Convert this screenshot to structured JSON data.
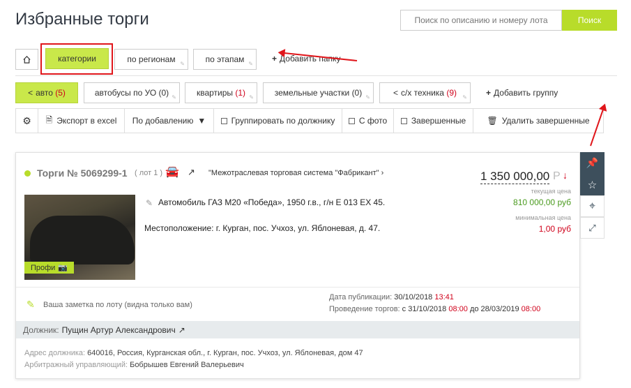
{
  "header": {
    "title": "Избранные торги",
    "search_placeholder": "Поиск по описанию и номеру лота",
    "search_button": "Поиск"
  },
  "folders": {
    "categories": "категории",
    "regions": "по регионам",
    "stages": "по этапам",
    "add_folder": "Добавить папку"
  },
  "groups": [
    {
      "label": "авто",
      "count": "(5)"
    },
    {
      "label": "автобусы по УО",
      "count": "(0)"
    },
    {
      "label": "квартиры",
      "count": "(1)"
    },
    {
      "label": "земельные участки",
      "count": "(0)"
    },
    {
      "label": "с/х техника",
      "count": "(9)"
    }
  ],
  "add_group": "Добавить группу",
  "toolbar": {
    "export": "Экспорт в excel",
    "sort": "По добавлению",
    "group_by_debtor": "Группировать по должнику",
    "with_photo": "С фото",
    "finished": "Завершенные",
    "delete_finished": "Удалить завершенные"
  },
  "lot": {
    "title": "Торги № 5069299-1",
    "lot_no": "( лот 1 )",
    "platform": "\"Межотраслевая торговая система \"Фабрикант\"",
    "price": "1 350 000,00",
    "currency": "Р",
    "current_price_label": "текущая цена",
    "current_price": "810 000,00 руб",
    "min_price_label": "минимальная цена",
    "min_price": "1,00 руб",
    "description": "Автомобиль ГАЗ М20 «Победа», 1950 г.в., г/н Е 013 ЕХ 45.",
    "location": "Местоположение: г. Курган, пос. Учхоз, ул. Яблоневая, д. 47.",
    "photo_badge": "Профи",
    "note": "Ваша заметка по лоту (видна только вам)",
    "pub_date_label": "Дата публикации:",
    "pub_date": "30/10/2018",
    "pub_time": "13:41",
    "trade_label": "Проведение торгов:",
    "trade_from": "с 31/10/2018",
    "trade_from_time": "08:00",
    "trade_to": "до 28/03/2019",
    "trade_to_time": "08:00",
    "debtor_label": "Должник:",
    "debtor": "Пущин Артур Александрович",
    "address_label": "Адрес должника:",
    "address": "640016, Россия, Курганская обл., г. Курган, пос. Учхоз, ул. Яблоневая, дом 47",
    "manager_label": "Арбитражный управляющий:",
    "manager": "Бобрышев Евгений Валерьевич"
  },
  "colors": {
    "accent": "#b8dc2a",
    "highlight": "#c9e84a",
    "red": "#d0021b",
    "dark": "#3d4f5c",
    "green_price": "#4a9a1e"
  }
}
